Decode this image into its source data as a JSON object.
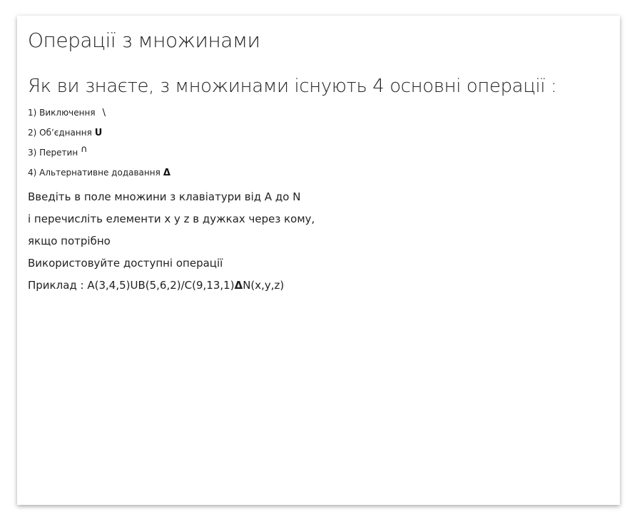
{
  "page": {
    "title": "Операції з множинами",
    "subtitle": "Як ви знаєте, з множинами існують 4 основні операції :"
  },
  "operations": [
    {
      "label": "1) Виключення",
      "symbol": "\\"
    },
    {
      "label": "2) Об’єднання",
      "symbol": "U"
    },
    {
      "label": "3) Перетин",
      "symbol": "∩"
    },
    {
      "label": "4) Альтернативне додавання",
      "symbol": "Δ"
    }
  ],
  "instructions": [
    "Введіть в поле множини з клавіатури від A до N",
    "і перечисліть елементи x y z в дужках через кому,",
    "якщо потрібно",
    "Використовуйте доступні операції"
  ],
  "example": {
    "prefix": "Приклад : A(3,4,5)UB(5,6,2)/C(9,13,1)",
    "symbol": "Δ",
    "suffix": "N(x,y,z)"
  }
}
